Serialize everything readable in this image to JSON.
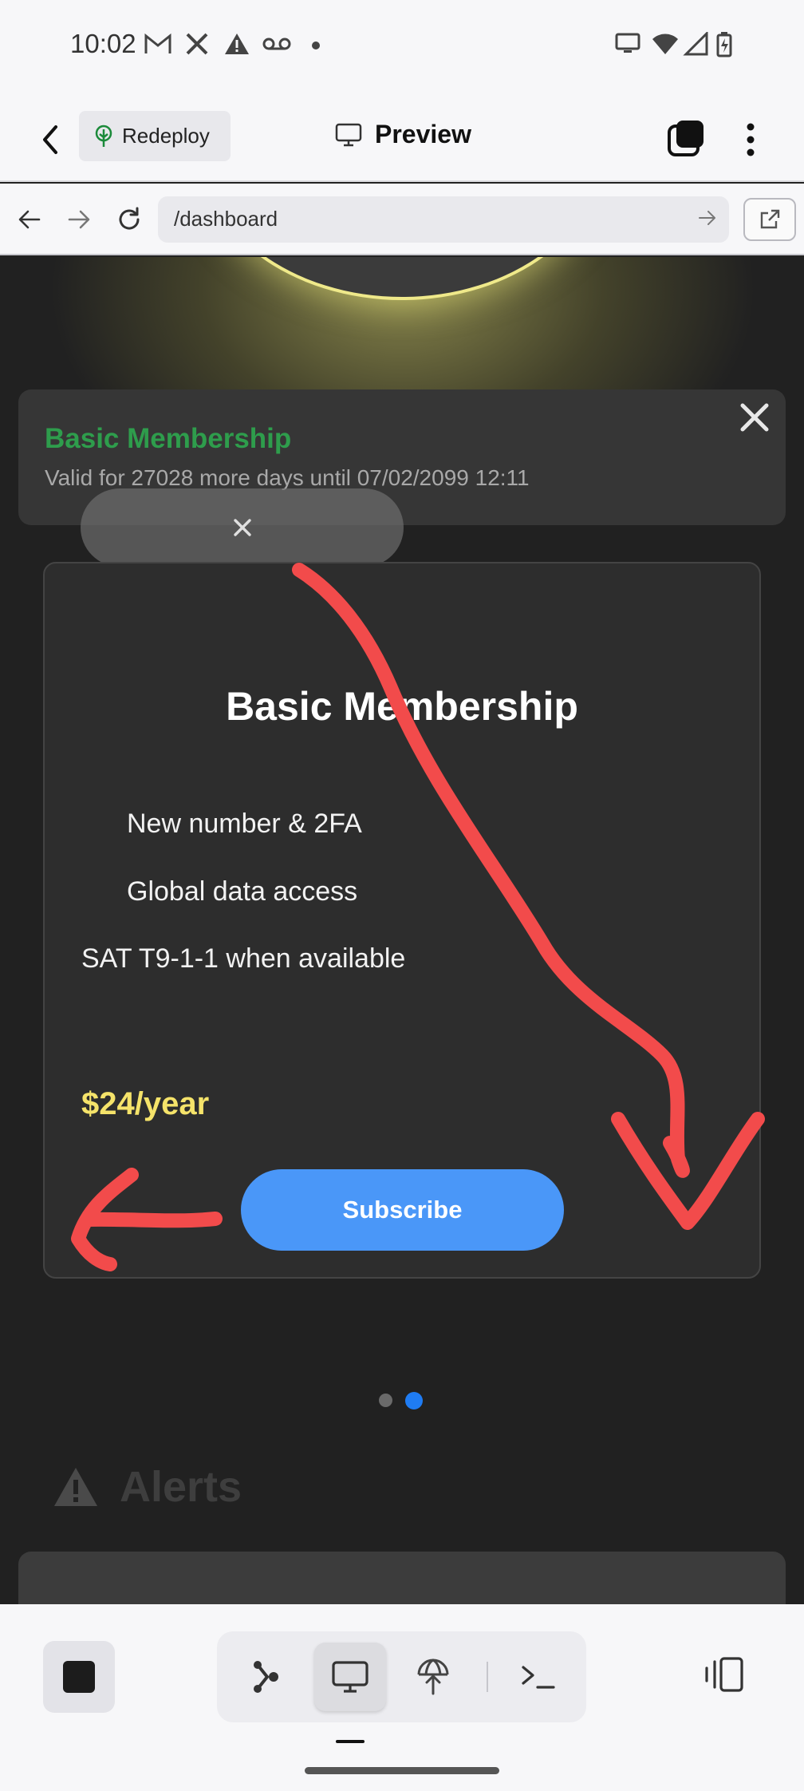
{
  "status_bar": {
    "time": "10:02",
    "left_icons": [
      "gmail-icon",
      "x-icon",
      "alert-icon",
      "voicemail-icon",
      "dot-icon"
    ],
    "right_icons": [
      "cast-icon",
      "wifi-icon",
      "signal-icon",
      "battery-charging-icon"
    ]
  },
  "app_header": {
    "redeploy_label": "Redeploy",
    "preview_label": "Preview"
  },
  "browser": {
    "url": "/dashboard"
  },
  "membership_banner": {
    "title": "Basic Membership",
    "subtitle": "Valid for 27028 more days until 07/02/2099 12:11",
    "title_color": "#2e9d4c"
  },
  "popup_pill": {
    "close_symbol": "×"
  },
  "plan_card": {
    "title": "Basic Membership",
    "features": [
      "New number & 2FA",
      "Global data access",
      "SAT T9-1-1 when available"
    ],
    "price": "$24/year",
    "price_color": "#f5e36a",
    "subscribe_label": "Subscribe",
    "button_color": "#4a97f8"
  },
  "carousel": {
    "page_count": 2,
    "active_page": 2
  },
  "alerts_section": {
    "heading": "Alerts"
  },
  "annotations": {
    "color": "#f24b4b",
    "marks": [
      "curved-arrow-down-right",
      "arrow-left"
    ]
  },
  "bottom_toolbar": {
    "buttons": [
      "stop-icon",
      "graph-icon",
      "desktop-icon",
      "deploy-icon",
      "terminal-icon",
      "layout-icon"
    ],
    "active": "desktop-icon"
  }
}
